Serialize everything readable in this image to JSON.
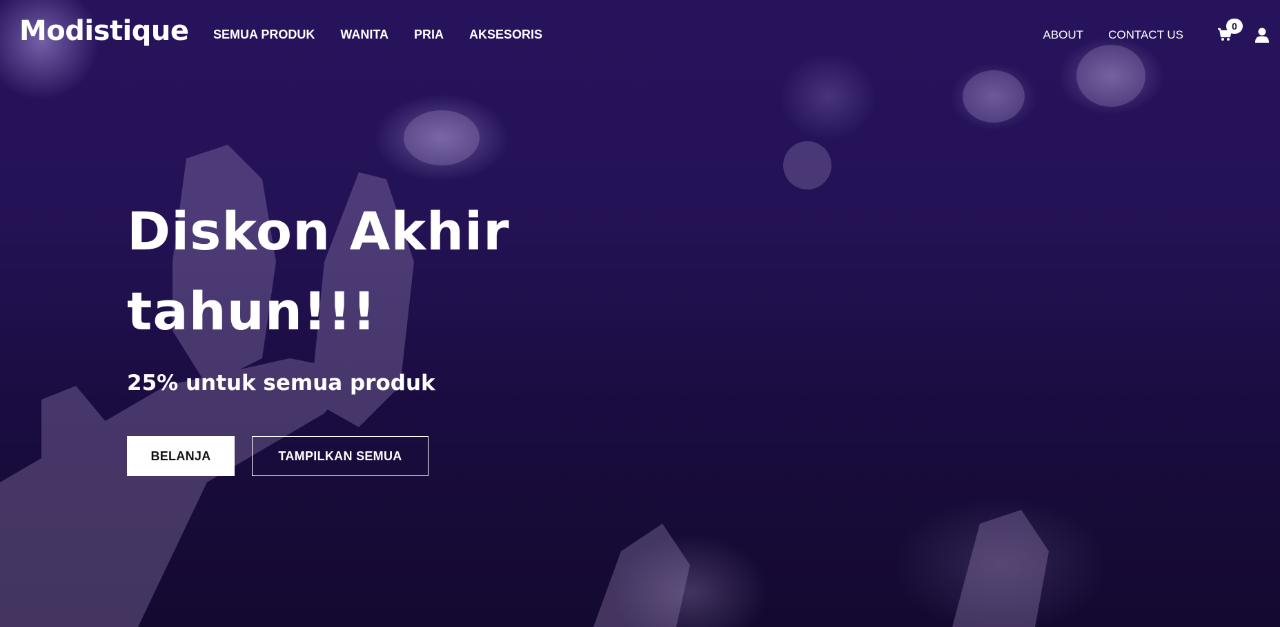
{
  "brand": {
    "name": "Modistique"
  },
  "nav": {
    "left_items": [
      {
        "label": "SEMUA PRODUK"
      },
      {
        "label": "WANITA"
      },
      {
        "label": "PRIA"
      },
      {
        "label": "AKSESORIS"
      }
    ],
    "right_items": [
      {
        "label": "ABOUT"
      },
      {
        "label": "CONTACT US"
      }
    ],
    "cart": {
      "icon": "cart-icon",
      "count": "0"
    },
    "user": {
      "icon": "user-icon"
    }
  },
  "hero": {
    "title_line1": "Diskon Akhir",
    "title_line2": "tahun!!!",
    "subtitle": "25% untuk semua produk",
    "primary_button": "BELANJA",
    "secondary_button": "TAMPILKAN SEMUA"
  },
  "colors": {
    "overlay": "#241255",
    "text": "#ffffff",
    "button_bg": "#ffffff",
    "button_text": "#111111"
  }
}
